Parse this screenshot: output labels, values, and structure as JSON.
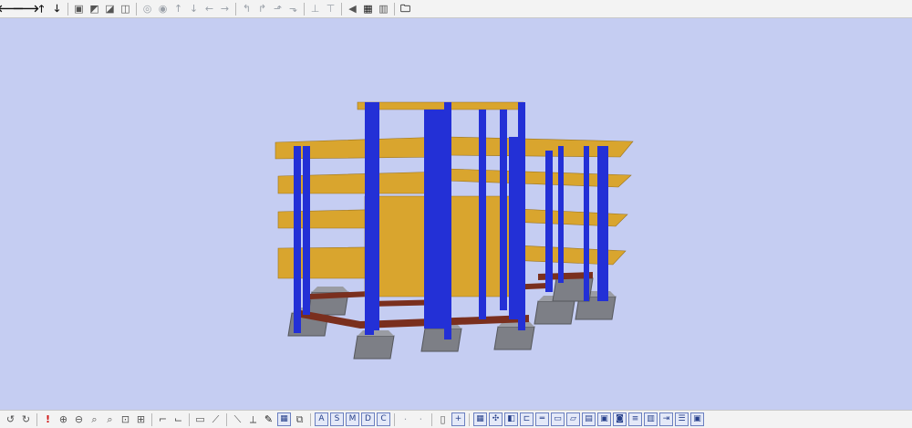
{
  "top_toolbar": {
    "groups": [
      [
        {
          "name": "arrow-left-icon",
          "glyph": "🡐",
          "style": "dark"
        },
        {
          "name": "arrow-right-icon",
          "glyph": "🡒",
          "style": "dark"
        },
        {
          "name": "arrow-up-icon",
          "glyph": "🡑",
          "style": "dark"
        },
        {
          "name": "arrow-down-icon",
          "glyph": "🡓",
          "style": "dark"
        }
      ],
      [
        {
          "name": "view-front-icon",
          "glyph": "▣",
          "style": ""
        },
        {
          "name": "view-side-icon",
          "glyph": "◩",
          "style": ""
        },
        {
          "name": "view-top-icon",
          "glyph": "◪",
          "style": ""
        },
        {
          "name": "view-iso-icon",
          "glyph": "◫",
          "style": ""
        }
      ],
      [
        {
          "name": "orbit-left-icon",
          "glyph": "◎",
          "style": "dim"
        },
        {
          "name": "orbit-right-icon",
          "glyph": "◉",
          "style": "dim"
        },
        {
          "name": "pan-up-icon",
          "glyph": "↑",
          "style": "dim"
        },
        {
          "name": "pan-down-icon",
          "glyph": "↓",
          "style": "dim"
        },
        {
          "name": "pan-left-icon",
          "glyph": "←",
          "style": "dim"
        },
        {
          "name": "pan-right-icon",
          "glyph": "→",
          "style": "dim"
        }
      ],
      [
        {
          "name": "rotate-left-icon",
          "glyph": "↰",
          "style": "dim"
        },
        {
          "name": "rotate-right-icon",
          "glyph": "↱",
          "style": "dim"
        },
        {
          "name": "tilt-up-icon",
          "glyph": "⬏",
          "style": "dim"
        },
        {
          "name": "tilt-down-icon",
          "glyph": "⬎",
          "style": "dim"
        }
      ],
      [
        {
          "name": "zoom-extent-icon",
          "glyph": "⊥",
          "style": "dim"
        },
        {
          "name": "zoom-axis-icon",
          "glyph": "⊤",
          "style": "dim"
        }
      ],
      [
        {
          "name": "sound-icon",
          "glyph": "◀",
          "style": ""
        },
        {
          "name": "render-mode-icon",
          "glyph": "▦",
          "style": "dark"
        },
        {
          "name": "bar-chart-icon",
          "glyph": "▥",
          "style": ""
        }
      ],
      [
        {
          "name": "open-folder-icon",
          "glyph": "🗀",
          "style": "dark"
        }
      ]
    ]
  },
  "bottom_toolbar": {
    "groups": [
      [
        {
          "name": "undo-view-icon",
          "glyph": "↺",
          "style": ""
        },
        {
          "name": "redo-view-icon",
          "glyph": "↻",
          "style": ""
        }
      ],
      [
        {
          "name": "alert-icon",
          "glyph": "!",
          "style": "red"
        },
        {
          "name": "zoom-in-icon",
          "glyph": "⊕",
          "style": ""
        },
        {
          "name": "zoom-out-icon",
          "glyph": "⊖",
          "style": ""
        },
        {
          "name": "zoom-window-icon",
          "glyph": "⌕",
          "style": ""
        },
        {
          "name": "zoom-previous-icon",
          "glyph": "⌕",
          "style": ""
        },
        {
          "name": "zoom-all-icon",
          "glyph": "⊡",
          "style": ""
        },
        {
          "name": "zoom-selection-icon",
          "glyph": "⊞",
          "style": ""
        }
      ],
      [
        {
          "name": "floor-plan-icon",
          "glyph": "⌐",
          "style": ""
        },
        {
          "name": "elevation-icon",
          "glyph": "⌙",
          "style": ""
        }
      ],
      [
        {
          "name": "measure-icon",
          "glyph": "▭",
          "style": ""
        },
        {
          "name": "draw-line-icon",
          "glyph": "⟋",
          "style": ""
        }
      ],
      [
        {
          "name": "node-select-icon",
          "glyph": "⟍",
          "style": ""
        },
        {
          "name": "member-select-icon",
          "glyph": "⟂",
          "style": ""
        },
        {
          "name": "paint-icon",
          "glyph": "✎",
          "style": "dark"
        },
        {
          "name": "grid-view-icon",
          "glyph": "▦",
          "style": "boxed"
        },
        {
          "name": "copy-view-icon",
          "glyph": "⧉",
          "style": ""
        }
      ],
      [
        {
          "name": "label-a-icon",
          "glyph": "A",
          "style": "boxed"
        },
        {
          "name": "label-s-icon",
          "glyph": "S",
          "style": "boxed"
        },
        {
          "name": "label-m-icon",
          "glyph": "M",
          "style": "boxed"
        },
        {
          "name": "label-d-icon",
          "glyph": "D",
          "style": "boxed"
        },
        {
          "name": "label-c-icon",
          "glyph": "C",
          "style": "boxed"
        }
      ],
      [
        {
          "name": "dim-one-icon",
          "glyph": "·",
          "style": "dim"
        },
        {
          "name": "dim-two-icon",
          "glyph": "⋅",
          "style": "dim"
        }
      ],
      [
        {
          "name": "mouse-icon",
          "glyph": "▯",
          "style": ""
        },
        {
          "name": "crosshair-icon",
          "glyph": "+",
          "style": "boxed"
        }
      ],
      [
        {
          "name": "grid-toggle-icon",
          "glyph": "▦",
          "style": "boxed"
        },
        {
          "name": "snap-icon",
          "glyph": "✣",
          "style": "boxed"
        },
        {
          "name": "layer-icon",
          "glyph": "◧",
          "style": "boxed"
        },
        {
          "name": "frame-icon",
          "glyph": "⊏",
          "style": "boxed"
        },
        {
          "name": "beam-icon",
          "glyph": "═",
          "style": "boxed"
        },
        {
          "name": "slab-icon",
          "glyph": "▭",
          "style": "boxed"
        },
        {
          "name": "panel-icon",
          "glyph": "▱",
          "style": "boxed"
        },
        {
          "name": "wall-icon",
          "glyph": "▤",
          "style": "boxed"
        },
        {
          "name": "opening-icon",
          "glyph": "▣",
          "style": "boxed"
        },
        {
          "name": "foundation-icon",
          "glyph": "◙",
          "style": "boxed"
        },
        {
          "name": "stair-icon",
          "glyph": "≡",
          "style": "boxed"
        },
        {
          "name": "table-icon",
          "glyph": "▥",
          "style": "boxed"
        },
        {
          "name": "export-icon",
          "glyph": "⇥",
          "style": "boxed"
        },
        {
          "name": "list-icon",
          "glyph": "☰",
          "style": "boxed"
        },
        {
          "name": "print-icon",
          "glyph": "▣",
          "style": "boxed"
        }
      ]
    ]
  },
  "model": {
    "slab_color": "#d9a52e",
    "column_color": "#2330d6",
    "beam_color": "#7a2f1e",
    "footing_color": "#7d7f86",
    "background_color": "#c5cdf2"
  }
}
